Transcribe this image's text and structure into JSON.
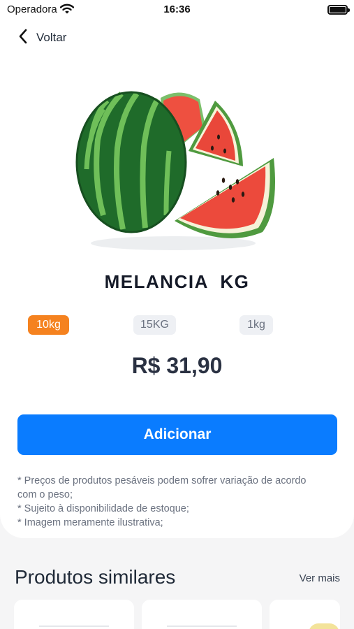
{
  "status_bar": {
    "carrier": "Operadora",
    "time": "16:36"
  },
  "nav": {
    "back_label": "Voltar",
    "back_icon": "chevron-left-icon"
  },
  "product": {
    "image": "watermelon-image",
    "name": "MELANCIA  KG",
    "price": "R$ 31,90",
    "weight_options": [
      {
        "label": "10kg",
        "selected": true
      },
      {
        "label": "15KG",
        "selected": false
      },
      {
        "label": "1kg",
        "selected": false
      }
    ],
    "add_button_label": "Adicionar",
    "notes": [
      "* Preços de produtos pesáveis podem sofrer variação de acordo com o peso;",
      "* Sujeito à disponibilidade de estoque;",
      "* Imagem meramente ilustrativa;"
    ]
  },
  "similar": {
    "title": "Produtos similares",
    "see_more_label": "Ver mais"
  },
  "colors": {
    "accent_blue": "#0a7cff",
    "selected_orange": "#f5821f",
    "page_background": "#f5f5f6"
  }
}
